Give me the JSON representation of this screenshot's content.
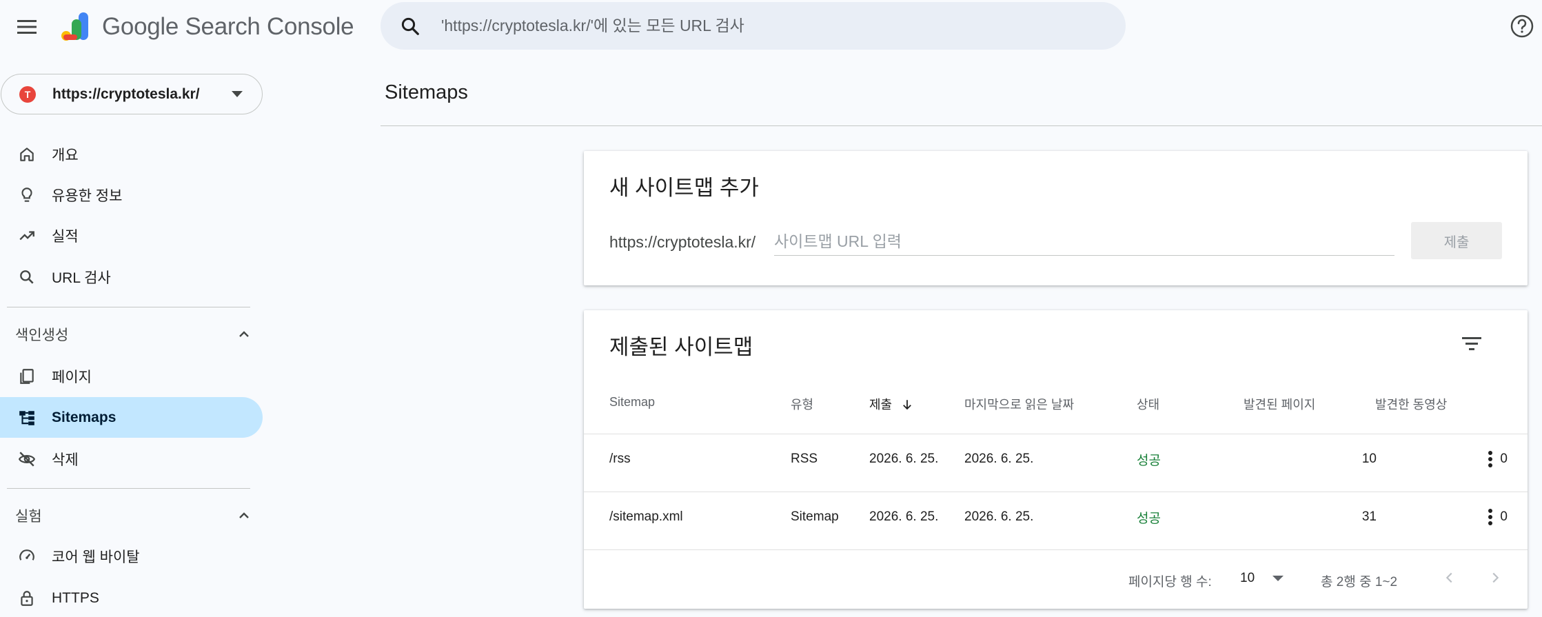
{
  "app": {
    "title_google": "Google",
    "title_product": "Search Console"
  },
  "search": {
    "placeholder": "'https://cryptotesla.kr/'에 있는 모든 URL 검사"
  },
  "property": {
    "label": "https://cryptotesla.kr/"
  },
  "sidebar": {
    "items": [
      {
        "label": "개요",
        "icon": "home-icon"
      },
      {
        "label": "유용한 정보",
        "icon": "lightbulb-icon"
      },
      {
        "label": "실적",
        "icon": "trending-up-icon"
      },
      {
        "label": "URL 검사",
        "icon": "search-icon"
      }
    ],
    "indexing": {
      "header": "색인생성",
      "items": [
        {
          "label": "페이지",
          "icon": "pages-icon"
        },
        {
          "label": "Sitemaps",
          "icon": "sitemap-icon",
          "active": true
        },
        {
          "label": "삭제",
          "icon": "visibility-off-icon"
        }
      ]
    },
    "experience": {
      "header": "실험",
      "items": [
        {
          "label": "코어 웹 바이탈",
          "icon": "speed-icon"
        },
        {
          "label": "HTTPS",
          "icon": "lock-icon"
        }
      ]
    }
  },
  "main": {
    "page_title": "Sitemaps",
    "add_card": {
      "title": "새 사이트맵 추가",
      "prefix": "https://cryptotesla.kr/",
      "input_placeholder": "사이트맵 URL 입력",
      "input_value": "",
      "submit_label": "제출"
    },
    "submitted_card": {
      "title": "제출된 사이트맵",
      "columns": [
        "Sitemap",
        "유형",
        "제출",
        "마지막으로 읽은 날짜",
        "상태",
        "발견된 페이지",
        "발견한 동영상"
      ],
      "sorted_column": "제출",
      "rows": [
        {
          "sitemap": "/rss",
          "type": "RSS",
          "submitted": "2026. 6. 25.",
          "last_read": "2026. 6. 25.",
          "status": "성공",
          "pages": "10",
          "videos": "0"
        },
        {
          "sitemap": "/sitemap.xml",
          "type": "Sitemap",
          "submitted": "2026. 6. 25.",
          "last_read": "2026. 6. 25.",
          "status": "성공",
          "pages": "31",
          "videos": "0"
        }
      ],
      "pagination": {
        "rows_per_page_label": "페이지당 행 수:",
        "rows_per_page": "10",
        "range": "총 2행 중 1~2"
      }
    }
  },
  "colors": {
    "accent_active": "#c2e7ff",
    "success": "#188038",
    "search_bg": "#e9eef6"
  }
}
